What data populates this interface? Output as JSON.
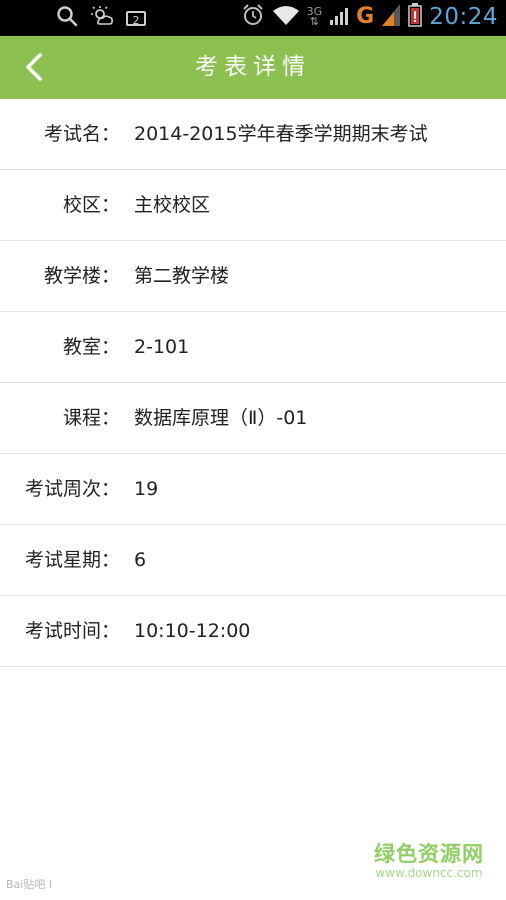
{
  "status_bar": {
    "notification_count": "2",
    "network_type_top": "3G",
    "network_type_bottom": "⇅",
    "carrier_mark": "G",
    "time": "20:24",
    "icons": [
      "search-icon",
      "weather-icon",
      "notification-badge",
      "alarm-icon",
      "wifi-icon",
      "network-3g-icon",
      "signal-bars-icon",
      "signal-g-icon",
      "signal-bars-2-icon",
      "battery-low-icon"
    ]
  },
  "header": {
    "title": "考表详情",
    "back_icon": "chevron-left-icon",
    "background": "#8cc152"
  },
  "details": [
    {
      "label": "考试名：",
      "value": "2014-2015学年春季学期期末考试"
    },
    {
      "label": "校区：",
      "value": "主校校区"
    },
    {
      "label": "教学楼：",
      "value": "第二教学楼"
    },
    {
      "label": "教室：",
      "value": "2-101"
    },
    {
      "label": "课程：",
      "value": "数据库原理（Ⅱ）-01"
    },
    {
      "label": "考试周次：",
      "value": "19"
    },
    {
      "label": "考试星期：",
      "value": "6"
    },
    {
      "label": "考试时间：",
      "value": "10:10-12:00"
    }
  ],
  "watermark": {
    "brand": "绿色资源网",
    "url": "www.downcc.com",
    "left_mark": "Bai贴吧 I"
  }
}
